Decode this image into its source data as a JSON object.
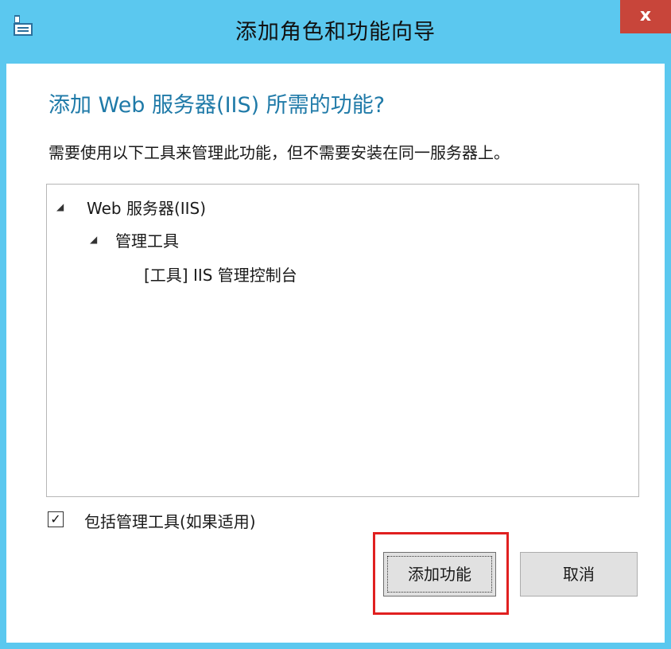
{
  "window": {
    "title": "添加角色和功能向导",
    "icon": "wizard-app-icon",
    "close_label": "x"
  },
  "dialog": {
    "heading": "添加 Web 服务器(IIS) 所需的功能?",
    "description": "需要使用以下工具来管理此功能，但不需要安装在同一服务器上。"
  },
  "tree": {
    "items": [
      {
        "label": "Web 服务器(IIS)",
        "expanded": true
      },
      {
        "label": "管理工具",
        "expanded": true
      },
      {
        "label": "[工具] IIS 管理控制台",
        "expanded": false
      }
    ]
  },
  "options": {
    "include_tools_label": "包括管理工具(如果适用)",
    "include_tools_checked": true
  },
  "buttons": {
    "add_features": "添加功能",
    "cancel": "取消"
  },
  "colors": {
    "titlebar": "#5bc8ef",
    "heading": "#1f7aa8",
    "close": "#c8453a",
    "highlight": "#e02020"
  }
}
